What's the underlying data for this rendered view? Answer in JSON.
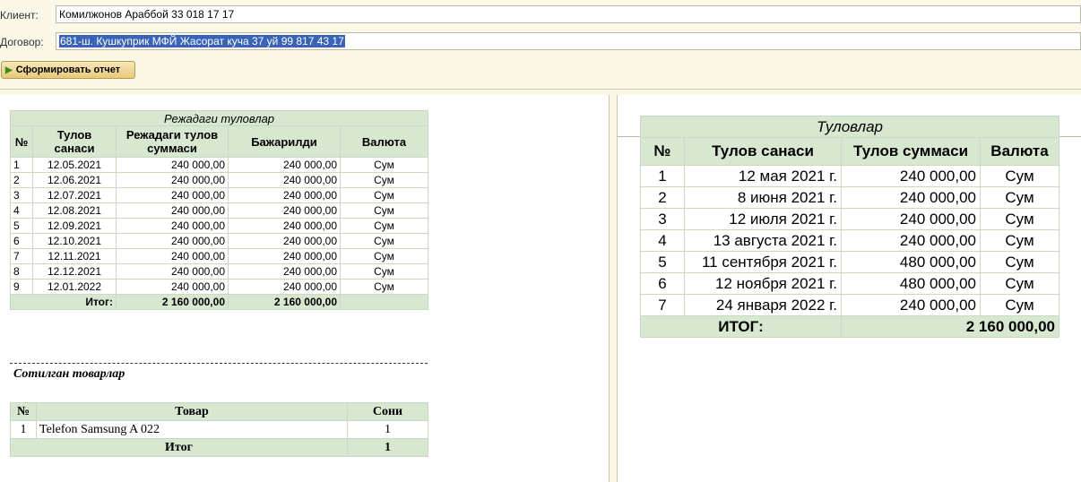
{
  "form": {
    "client_label": "Клиент:",
    "client_value": "Комилжонов Араббой 33 018 17 17",
    "contract_label": "Договор:",
    "contract_value": "681-ш. Кушкуприк МФЙ  Жасорат куча  37 уй  99 817 43 17",
    "generate_button": "Сформировать отчет"
  },
  "schedule": {
    "title": "Режадаги туловлар",
    "headers": [
      "№",
      "Тулов санаси",
      "Режадаги тулов суммаси",
      "Бажарилди",
      "Валюта"
    ],
    "rows": [
      [
        "1",
        "12.05.2021",
        "240 000,00",
        "240 000,00",
        "Сум"
      ],
      [
        "2",
        "12.06.2021",
        "240 000,00",
        "240 000,00",
        "Сум"
      ],
      [
        "3",
        "12.07.2021",
        "240 000,00",
        "240 000,00",
        "Сум"
      ],
      [
        "4",
        "12.08.2021",
        "240 000,00",
        "240 000,00",
        "Сум"
      ],
      [
        "5",
        "12.09.2021",
        "240 000,00",
        "240 000,00",
        "Сум"
      ],
      [
        "6",
        "12.10.2021",
        "240 000,00",
        "240 000,00",
        "Сум"
      ],
      [
        "7",
        "12.11.2021",
        "240 000,00",
        "240 000,00",
        "Сум"
      ],
      [
        "8",
        "12.12.2021",
        "240 000,00",
        "240 000,00",
        "Сум"
      ],
      [
        "9",
        "12.01.2022",
        "240 000,00",
        "240 000,00",
        "Сум"
      ]
    ],
    "total_label": "Итог:",
    "total_planned": "2 160 000,00",
    "total_done": "2 160 000,00"
  },
  "sold": {
    "title": "Сотилган товарлар",
    "headers": [
      "№",
      "Товар",
      "Сони"
    ],
    "rows": [
      [
        "1",
        "Telefon Samsung A 022",
        "1"
      ]
    ],
    "total_label": "Итог",
    "total_value": "1"
  },
  "payments": {
    "title": "Туловлар",
    "headers": [
      "№",
      "Тулов санаси",
      "Тулов суммаси",
      "Валюта"
    ],
    "rows": [
      [
        "1",
        "12 мая 2021 г.",
        "240 000,00",
        "Сум"
      ],
      [
        "2",
        "8 июня 2021 г.",
        "240 000,00",
        "Сум"
      ],
      [
        "3",
        "12 июля 2021 г.",
        "240 000,00",
        "Сум"
      ],
      [
        "4",
        "13 августа 2021 г.",
        "240 000,00",
        "Сум"
      ],
      [
        "5",
        "11 сентября 2021 г.",
        "480 000,00",
        "Сум"
      ],
      [
        "6",
        "12 ноября 2021 г.",
        "480 000,00",
        "Сум"
      ],
      [
        "7",
        "24 января 2022 г.",
        "240 000,00",
        "Сум"
      ]
    ],
    "total_label": "ИТОГ:",
    "total_value": "2 160 000,00"
  }
}
